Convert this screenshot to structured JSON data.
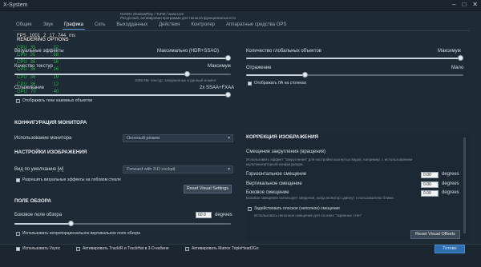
{
  "window": {
    "title": "X-System"
  },
  "overlay": {
    "line1": "NVIDIA ShadowPlay / TuFM / www.com",
    "line2": "Ресурсный, активирован программа для тюнинга функциональности"
  },
  "tabs": [
    "Общие",
    "Звук",
    "Графика",
    "Сеть",
    "Выходданных",
    "Действия",
    "Контролер",
    "Аппаратные средства GPS"
  ],
  "hud": {
    "header": {
      "fps_label": "FPS",
      "fps_a": "1001",
      "fps_b": "2",
      "fps_c": "17",
      "fps_d": "744",
      "fps_unit": "ms"
    },
    "title": "RENDERING OPTIONS",
    "rows": [
      {
        "a": "CPU",
        "b": "35",
        "c": "32"
      },
      {
        "a": "CPU",
        "b": "35",
        "c": "68"
      },
      {
        "a": "CPU",
        "b": "36",
        "c": "16"
      },
      {
        "a": "CPU",
        "b": "36",
        "c": "16"
      },
      {
        "a": "CPU",
        "b": "36",
        "c": "19"
      },
      {
        "a": "CPU",
        "b": "36",
        "c": "12"
      },
      {
        "a": "GPU",
        "b": "70",
        "c": "40"
      }
    ]
  },
  "left": {
    "visual_effects": {
      "label": "Визуальные эффекты",
      "value": "Максимально (HDR+SSAO)"
    },
    "texture_quality": {
      "label": "Качество текстур",
      "value": "Максимум",
      "note": "2095 МБ текстур, загруженных в данный момент"
    },
    "smoothing": {
      "label": "Сглаживание",
      "value": "2x SSAA+FXAA"
    },
    "shadows_checkbox": "Отображать тени наземных объектов",
    "monitor_config_title": "КОНФИГУРАЦИЯ МОНИТОРА",
    "monitor_use": {
      "label": "Использование монитора",
      "value": "Оконный режим"
    },
    "image_settings_title": "НАСТРОЙКИ ИЗОБРАЖЕНИЯ",
    "default_view": {
      "label": "Вид по умолчанию [w]",
      "value": "Forward with 3-D cockpit"
    },
    "allow_visual_effects": "Разрешить визуальные эффекты на лобовом стекле",
    "reset_visual_settings": "Reset Visual Settings",
    "fov_title": "ПОЛЕ ОБЗОРА",
    "lateral_fov": {
      "label": "Боковое поле обзора",
      "value": "60.0",
      "unit": "degrees"
    },
    "nonproportional": "Использовать непропорциональное вертикальное поле обзора"
  },
  "right": {
    "global_objects": {
      "label": "Количество глобальных объектов",
      "value": "Максимум"
    },
    "reflections": {
      "label": "Отражение",
      "value": "Мало"
    },
    "show_lod": "Отображать ЛА на стоянках",
    "image_correction_title": "КОРРЕКЦИЯ ИЗОБРАЖЕНИЯ",
    "curvature_title": "Смещение закругления (вращения)",
    "curvature_note1": "Использовать эффект \"закругления\" для настройки изогнутых видов, например, с использованием",
    "curvature_note2": "мультимониторной конфигурации.",
    "horizontal": {
      "label": "Горизонтальное смещение",
      "value": "0.00",
      "unit": "degrees"
    },
    "vertical": {
      "label": "Вертикальное смещение",
      "value": "0.00",
      "unit": "degrees"
    },
    "lateral": {
      "label": "Боковое смещение",
      "value": "0.00",
      "unit": "degrees"
    },
    "lateral_note": "Боковое смещение использует сведения, когда монитор сдвинут к пользователю ближе.",
    "plane_offset": "Задействовать плоское (неполное) смещение",
    "plane_note": "Использовать неполное смещение для плоских \"экранных стен\"",
    "reset_visual_offsets": "Reset Visual Offsets"
  },
  "bottom": {
    "vsync": "Использовать Vsync",
    "trackir": "Активировать TrackIR и TrackHat в 3-D-кабине",
    "matrox": "Активировать Matrox TripleHead2Go",
    "done": "Готово"
  }
}
